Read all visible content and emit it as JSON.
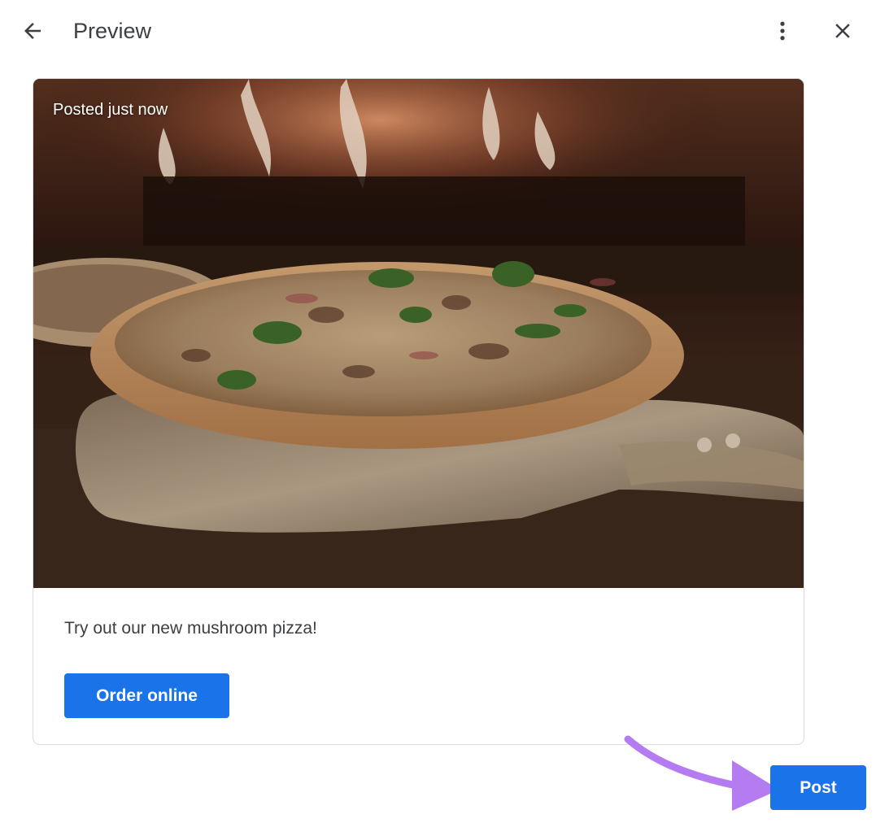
{
  "header": {
    "title": "Preview",
    "back_icon": "arrow-back-icon",
    "more_icon": "more-vert-icon",
    "close_icon": "close-icon"
  },
  "card": {
    "image_alt": "pizza on peel in front of wood-fired oven",
    "posted_label": "Posted just now",
    "caption": "Try out our new mushroom pizza!",
    "button_label": "Order online"
  },
  "footer": {
    "post_label": "Post",
    "annotation_icon": "curved-arrow-icon"
  },
  "colors": {
    "primary": "#1a73e8",
    "text": "#3c4043",
    "icon": "#5f6368",
    "annotation": "#b57cf2"
  }
}
